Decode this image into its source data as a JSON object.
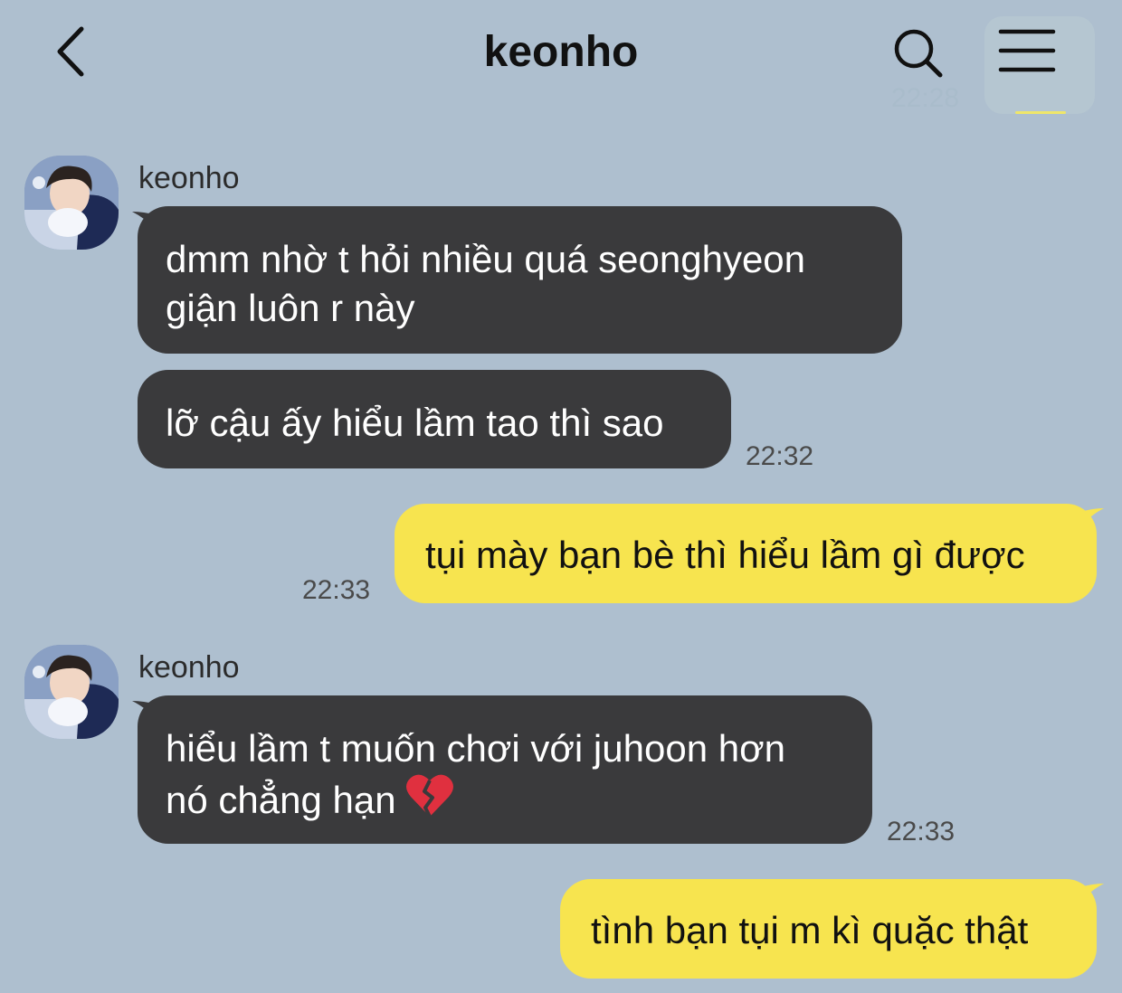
{
  "header": {
    "title": "keonho",
    "faded_time": "22:28"
  },
  "colors": {
    "background": "#aebfcf",
    "incoming_bubble": "#3a3a3c",
    "outgoing_bubble": "#f7e44f",
    "incoming_text": "#ffffff",
    "outgoing_text": "#111111"
  },
  "icons": {
    "back": "chevron-left-icon",
    "search": "search-icon",
    "menu": "hamburger-menu-icon",
    "reaction": "broken-heart-emoji"
  },
  "messages": [
    {
      "sender": "keonho",
      "lines": [
        "dmm nhờ t hỏi nhiều quá seonghyeon",
        "giận luôn r này"
      ]
    },
    {
      "lines": [
        "lỡ cậu ấy hiểu lầm tao thì sao"
      ],
      "time": "22:32"
    },
    {
      "outgoing": true,
      "lines": [
        "tụi mày bạn bè thì hiểu lầm gì được"
      ],
      "time": "22:33"
    },
    {
      "sender": "keonho",
      "lines": [
        "hiểu lầm t muốn chơi với juhoon hơn",
        "nó chẳng hạn"
      ],
      "time": "22:33"
    },
    {
      "outgoing": true,
      "lines": [
        "tình bạn tụi m kì quặc thật"
      ]
    }
  ]
}
